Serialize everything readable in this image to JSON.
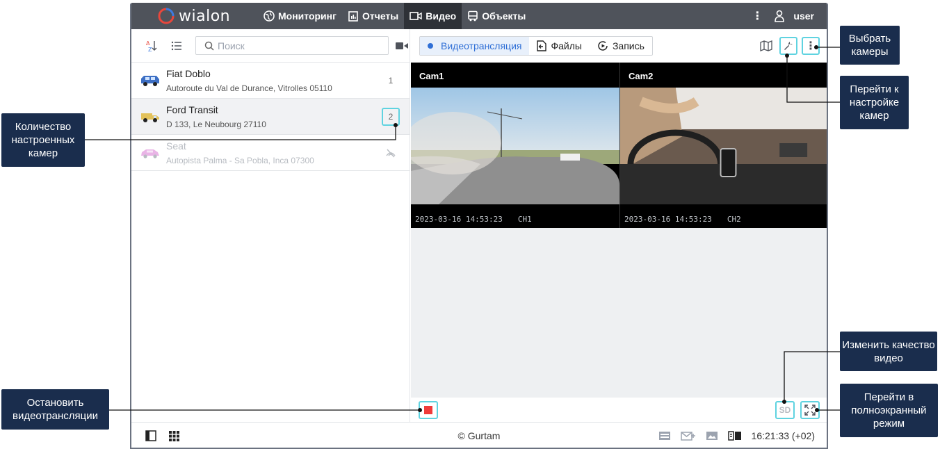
{
  "app": {
    "logo_text": "wialon",
    "nav": [
      {
        "label": "Мониторинг",
        "icon": "globe-icon"
      },
      {
        "label": "Отчеты",
        "icon": "report-icon"
      },
      {
        "label": "Видео",
        "icon": "video-icon",
        "active": true
      },
      {
        "label": "Объекты",
        "icon": "bus-icon"
      }
    ],
    "user": "user"
  },
  "left_panel": {
    "search_placeholder": "Поиск",
    "units": [
      {
        "name": "Fiat Doblo",
        "address": "Autoroute du Val de Durance, Vitrolles 05110",
        "cameras": "1",
        "selected": false,
        "disabled": false
      },
      {
        "name": "Ford Transit",
        "address": "D 133, Le Neubourg 27110",
        "cameras": "2",
        "selected": true,
        "disabled": false
      },
      {
        "name": "Seat",
        "address": "Autopista Palma - Sa Pobla, Inca 07300",
        "cameras": "",
        "selected": false,
        "disabled": true
      }
    ]
  },
  "right_panel": {
    "tabs": [
      {
        "label": "Видеотрансляция",
        "active": true
      },
      {
        "label": "Файлы",
        "active": false
      },
      {
        "label": "Запись",
        "active": false
      }
    ],
    "videos": [
      {
        "label": "Cam1",
        "timestamp": "2023-03-16 14:53:23",
        "channel": "CH1"
      },
      {
        "label": "Cam2",
        "timestamp": "2023-03-16 14:53:23",
        "channel": "CH2"
      }
    ],
    "quality_label": "SD"
  },
  "footer": {
    "copyright": "© Gurtam",
    "time": "16:21:33 (+02)"
  },
  "callouts": {
    "select_cameras": "Выбрать камеры",
    "camera_settings": "Перейти к настройке камер",
    "camera_count": "Количество настроенных камер",
    "change_quality": "Изменить качество видео",
    "stop_stream": "Остановить видеотрансляции",
    "fullscreen": "Перейти в полноэкранный режим"
  },
  "colors": {
    "topbar": "#4f535b",
    "accent": "#2f6fd6",
    "highlight": "#5fd3e0",
    "callout": "#1a2d4d",
    "stop": "#ef3b3b"
  }
}
